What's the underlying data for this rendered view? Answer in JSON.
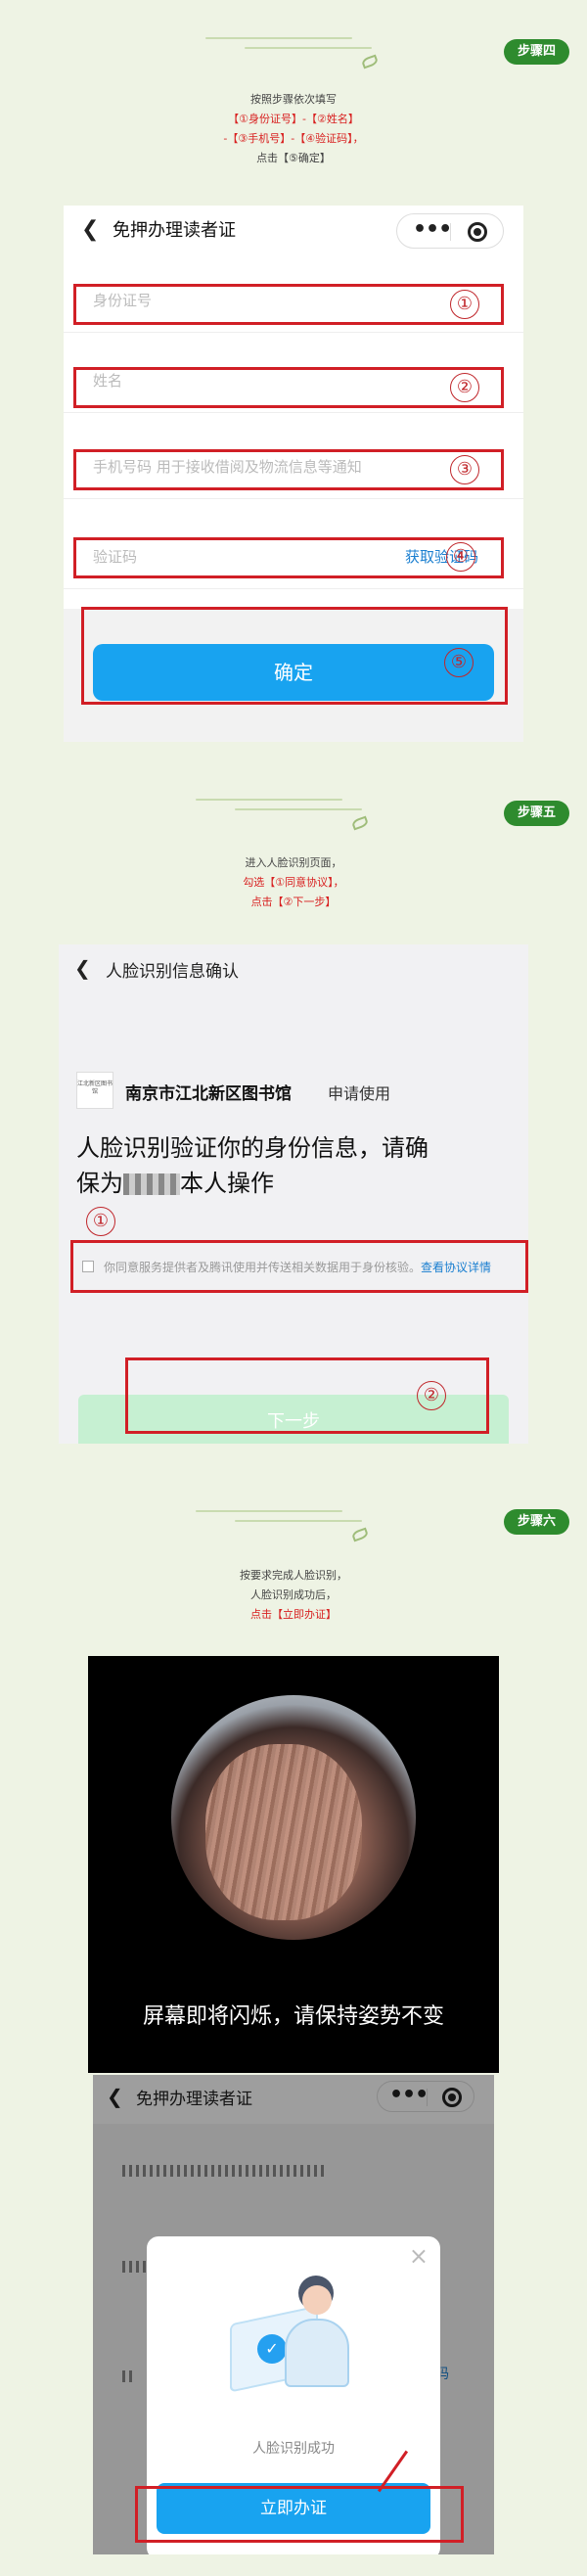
{
  "steps": [
    {
      "badge": "步骤四",
      "instructions": [
        "按照步骤依次填写",
        "【①身份证号】-【②姓名】",
        "-【③手机号】-【④验证码】，",
        "点击【⑤确定】"
      ]
    },
    {
      "badge": "步骤五",
      "instructions": [
        "进入人脸识别页面，",
        "勾选【①同意协议】，",
        "点击【②下一步】"
      ]
    },
    {
      "badge": "步骤六",
      "instructions": [
        "按要求完成人脸识别，",
        "人脸识别成功后，",
        "点击【立即办证】"
      ]
    }
  ],
  "screen1": {
    "title": "免押办理读者证",
    "fields": [
      {
        "placeholder": "身份证号",
        "num": "①"
      },
      {
        "placeholder": "姓名",
        "num": "②"
      },
      {
        "placeholder": "手机号码 用于接收借阅及物流信息等通知",
        "num": "③"
      },
      {
        "placeholder": "验证码",
        "num": "④",
        "action": "获取验证码"
      }
    ],
    "confirm_label": "确定",
    "confirm_num": "⑤"
  },
  "screen2": {
    "title": "人脸识别信息确认",
    "org_name": "南京市江北新区图书馆",
    "org_action": "申请使用",
    "logo_text": "江北新区图书馆",
    "heading_line1": "人脸识别验证你的身份信息，请确",
    "heading_line2_prefix": "保为",
    "heading_line2_suffix": "本人操作",
    "num1": "①",
    "agreement": "你同意服务提供者及腾讯使用并传送相关数据用于身份核验。",
    "agreement_link": "查看协议详情",
    "next_label": "下一步",
    "num2": "②"
  },
  "screen3": {
    "face_prompt": "屏幕即将闪烁，请保持姿势不变",
    "title": "免押办理读者证",
    "success_text": "人脸识别成功",
    "issue_label": "立即办证",
    "close_glyph": "×",
    "peek_link": "码"
  },
  "colors": {
    "accent_green": "#2e8b2e",
    "highlight_red": "#d11f26",
    "brand_blue": "#18a3f0",
    "page_bg": "#eef3e4"
  }
}
